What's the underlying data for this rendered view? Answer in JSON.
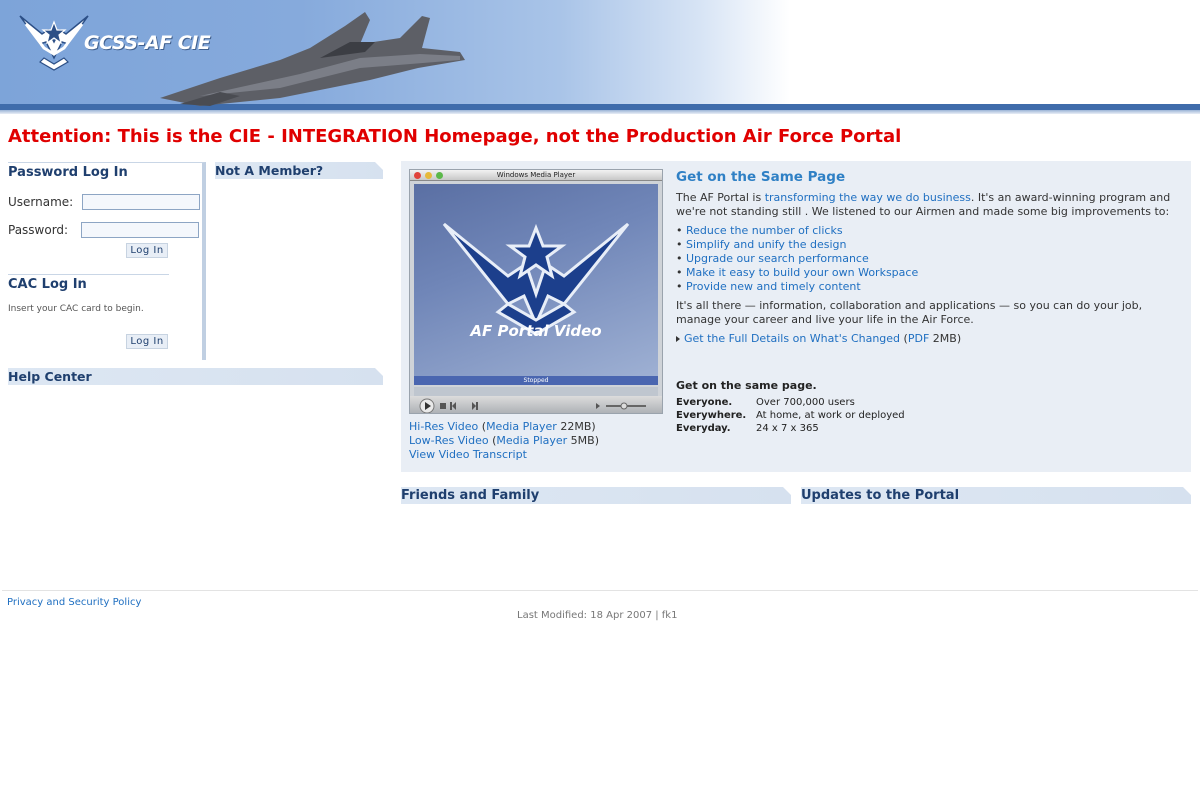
{
  "header": {
    "logo_text": "GCSS-AF CIE"
  },
  "attention": "Attention: This is the CIE - INTEGRATION Homepage, not the Production Air Force Portal",
  "login": {
    "title": "Password Log In",
    "username_label": "Username:",
    "password_label": "Password:",
    "username_value": "",
    "password_value": "",
    "button": "Log In"
  },
  "cac": {
    "title": "CAC Log In",
    "hint": "Insert your CAC card to begin.",
    "button": "Log In"
  },
  "not_member": "Not A Member?",
  "help_center": "Help Center",
  "video": {
    "player_title": "Windows Media Player",
    "caption": "AF Portal Video",
    "status": "Stopped",
    "hires": "Hi-Res Video",
    "hires_player": "Media Player",
    "hires_size": "22MB)",
    "lowres": "Low-Res Video",
    "lowres_player": "Media Player",
    "lowres_size": "5MB)",
    "transcript": "View Video Transcript"
  },
  "same_page": {
    "title": "Get on the Same Page",
    "intro_before": "The AF Portal is ",
    "intro_link": "transforming the way we do business",
    "intro_after": ". It's an award-winning program and we're not standing still . We listened to our Airmen and made some big improvements to:",
    "items": [
      "Reduce the number of clicks",
      "Simplify and unify the design",
      "Upgrade our search performance",
      "Make it easy to build your own Workspace",
      "Provide new and timely content"
    ],
    "body": "It's all there — information, collaboration and applications — so you can do your job, manage your career and live your life in the Air Force.",
    "details_link": "Get the Full Details on What's Changed",
    "pdf_link": "PDF",
    "pdf_size": "2MB)",
    "tagline_title": "Get on the same page.",
    "taglines": [
      {
        "k": "Everyone.",
        "v": "Over 700,000 users"
      },
      {
        "k": "Everywhere.",
        "v": "At home, at work or deployed"
      },
      {
        "k": "Everyday.",
        "v": "24 x 7 x 365"
      }
    ]
  },
  "friends_family": "Friends and Family",
  "updates": "Updates to the Portal",
  "footer": {
    "privacy": "Privacy and Security Policy",
    "last_modified": "Last Modified: 18 Apr 2007  |   fk1"
  },
  "colors": {
    "attention": "#e00000",
    "link": "#1f6fc1",
    "heading": "#1f3f6e",
    "feature_bg": "#e9eef5"
  },
  "icons": [
    "air-force-wings-icon",
    "jet-image",
    "bullet-arrow-icon"
  ]
}
